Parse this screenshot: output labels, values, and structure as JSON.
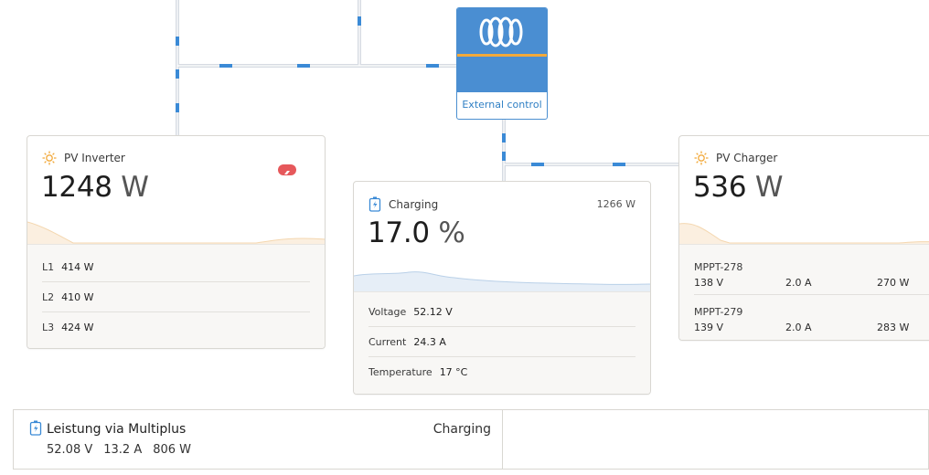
{
  "colors": {
    "wire": "#d6dbe2",
    "wire_flow": "#3b8ad6",
    "accent_orange": "#f2a93b",
    "brand_blue": "#4a8ed2",
    "alarm_red": "#e6585b"
  },
  "external_control": {
    "label": "External control",
    "icon": "victron-logo-icon"
  },
  "pv_inverter": {
    "title": "PV Inverter",
    "icon": "sun-icon",
    "alarm_icon": "alarm-badge-icon",
    "power_value": "1248",
    "power_unit": "W",
    "phases": [
      {
        "label": "L1",
        "value": "414 W"
      },
      {
        "label": "L2",
        "value": "410 W"
      },
      {
        "label": "L3",
        "value": "424 W"
      }
    ]
  },
  "battery": {
    "title": "Charging",
    "icon": "battery-icon",
    "power": "1266 W",
    "soc_value": "17.0",
    "soc_unit": "%",
    "rows": [
      {
        "label": "Voltage",
        "value": "52.12 V"
      },
      {
        "label": "Current",
        "value": "24.3 A"
      },
      {
        "label": "Temperature",
        "value": "17 °C"
      }
    ]
  },
  "pv_charger": {
    "title": "PV Charger",
    "icon": "sun-icon",
    "power_value": "536",
    "power_unit": "W",
    "trackers": [
      {
        "name": "MPPT-278",
        "voltage": "138 V",
        "current": "2.0 A",
        "power": "270 W"
      },
      {
        "name": "MPPT-279",
        "voltage": "139 V",
        "current": "2.0 A",
        "power": "283 W"
      }
    ]
  },
  "multiplus_bar": {
    "title": "Leistung via Multiplus",
    "icon": "battery-icon",
    "state": "Charging",
    "voltage": "52.08 V",
    "current": "13.2 A",
    "power": "806 W"
  }
}
